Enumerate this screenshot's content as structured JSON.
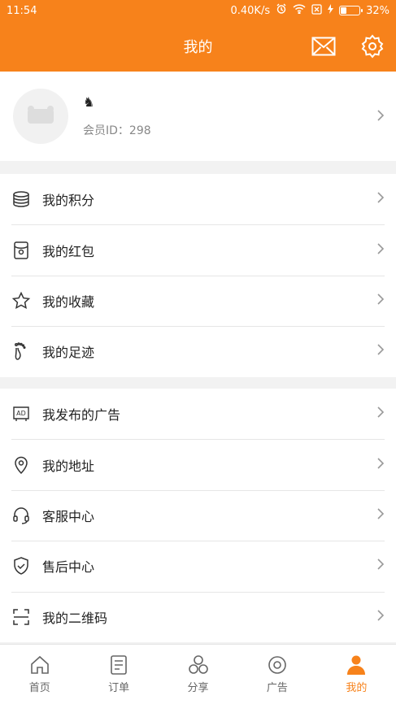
{
  "status_bar": {
    "time": "11:54",
    "network_speed": "0.40K/s",
    "battery_percent": "32%",
    "battery_level": 0.32
  },
  "header": {
    "title": "我的",
    "message_icon": "envelope-icon",
    "settings_icon": "gear-icon"
  },
  "profile": {
    "nickname": "♞",
    "member_id": "会员ID：298"
  },
  "menu_group_1": [
    {
      "label": "我的积分",
      "icon": "coins-stack-icon"
    },
    {
      "label": "我的红包",
      "icon": "red-packet-icon"
    },
    {
      "label": "我的收藏",
      "icon": "star-icon"
    },
    {
      "label": "我的足迹",
      "icon": "footprint-icon"
    }
  ],
  "menu_group_2": [
    {
      "label": "我发布的广告",
      "icon": "ad-icon"
    },
    {
      "label": "我的地址",
      "icon": "location-pin-icon"
    },
    {
      "label": "客服中心",
      "icon": "headset-icon"
    },
    {
      "label": "售后中心",
      "icon": "shield-check-icon"
    },
    {
      "label": "我的二维码",
      "icon": "qr-scan-icon"
    }
  ],
  "tabs": [
    {
      "label": "首页",
      "icon": "home-icon",
      "active": false
    },
    {
      "label": "订单",
      "icon": "order-list-icon",
      "active": false
    },
    {
      "label": "分享",
      "icon": "share-circles-icon",
      "active": false
    },
    {
      "label": "广告",
      "icon": "ad-target-icon",
      "active": false
    },
    {
      "label": "我的",
      "icon": "user-icon",
      "active": true
    }
  ],
  "colors": {
    "brand": "#f7821b",
    "background": "#f2f2f2",
    "text": "#222222",
    "muted": "#888888"
  }
}
